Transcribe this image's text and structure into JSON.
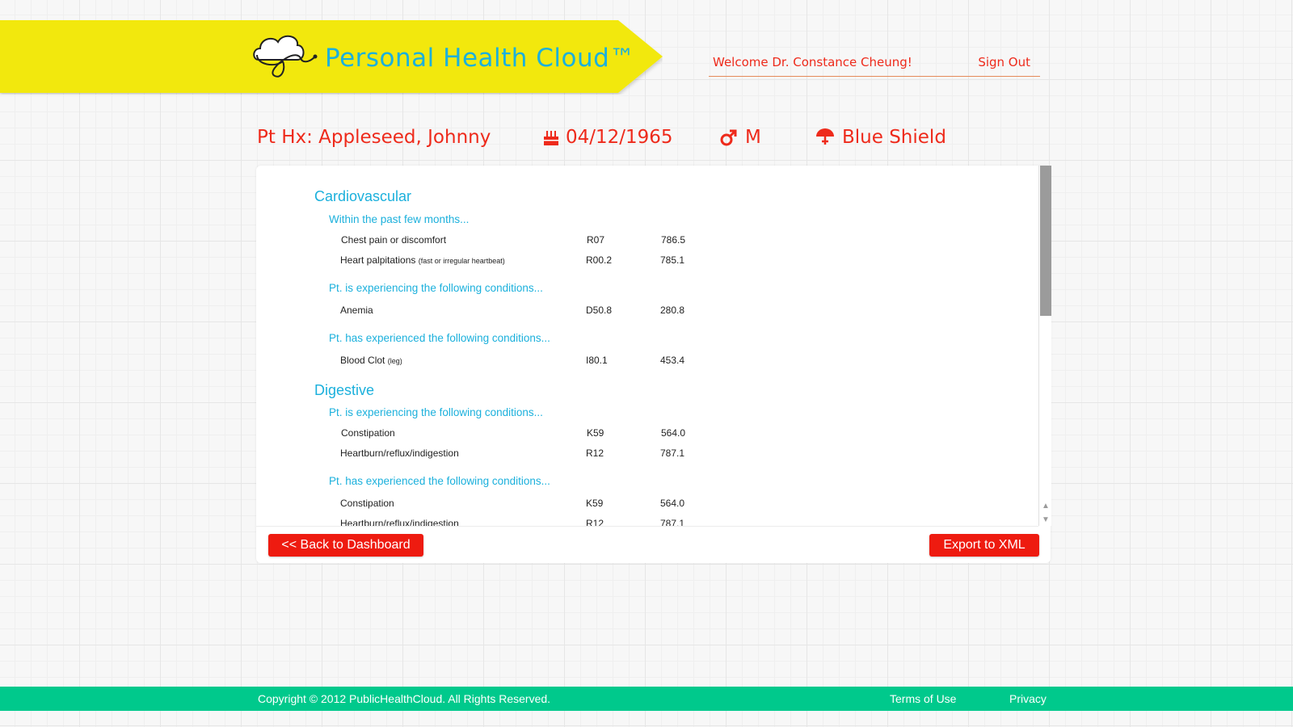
{
  "header": {
    "app_title": "Personal Health Cloud™",
    "welcome": "Welcome Dr. Constance Cheung!",
    "sign_out": "Sign Out"
  },
  "patient": {
    "name_line": "Pt Hx: Appleseed, Johnny",
    "dob": "04/12/1965",
    "sex": "M",
    "insurance": "Blue Shield",
    "icons": {
      "dob": "birthday-cake-icon",
      "sex": "male-symbol-icon",
      "insurance": "umbrella-icon"
    }
  },
  "sections": [
    {
      "title": "Cardiovascular",
      "groups": [
        {
          "heading": "Within the past few months...",
          "rows": [
            {
              "condition": "Chest pain or discomfort",
              "note": "",
              "icd10": "R07",
              "icd9": "786.5"
            },
            {
              "condition": "Heart palpitations",
              "note": "(fast or irregular heartbeat)",
              "icd10": "R00.2",
              "icd9": "785.1"
            }
          ]
        },
        {
          "heading": "Pt. is experiencing the following conditions...",
          "rows": [
            {
              "condition": "Anemia",
              "note": "",
              "icd10": "D50.8",
              "icd9": "280.8"
            }
          ]
        },
        {
          "heading": "Pt. has experienced the following conditions...",
          "rows": [
            {
              "condition": "Blood Clot",
              "note": "(leg)",
              "icd10": "I80.1",
              "icd9": "453.4"
            }
          ]
        }
      ]
    },
    {
      "title": "Digestive",
      "groups": [
        {
          "heading": "Pt. is experiencing the following conditions...",
          "rows": [
            {
              "condition": "Constipation",
              "note": "",
              "icd10": "K59",
              "icd9": "564.0"
            },
            {
              "condition": "Heartburn/reflux/indigestion",
              "note": "",
              "icd10": "R12",
              "icd9": "787.1"
            }
          ]
        },
        {
          "heading": "Pt. has experienced the following conditions...",
          "rows": [
            {
              "condition": "Constipation",
              "note": "",
              "icd10": "K59",
              "icd9": "564.0"
            },
            {
              "condition": "Heartburn/reflux/indigestion",
              "note": "",
              "icd10": "R12",
              "icd9": "787.1"
            }
          ]
        }
      ]
    }
  ],
  "buttons": {
    "back": "<< Back to Dashboard",
    "export": "Export to XML"
  },
  "footer": {
    "copyright": "Copyright © 2012 PublicHealthCloud. All Rights Reserved.",
    "terms": "Terms of Use",
    "privacy": "Privacy"
  },
  "colors": {
    "banner": "#f2e80f",
    "accent_red": "#ee2a1b",
    "accent_blue": "#1bb0dc",
    "footer": "#00c98c"
  }
}
